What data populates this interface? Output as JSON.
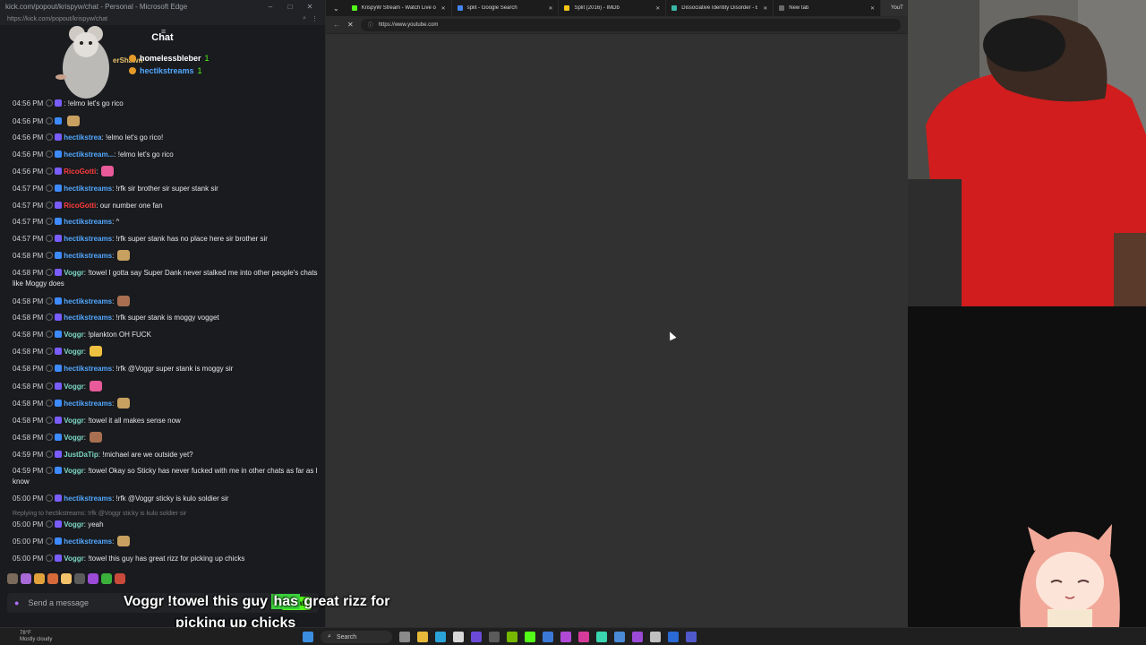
{
  "chat_window": {
    "title": "kick.com/popout/krispyw/chat - Personal - Microsoft Edge",
    "url": "https://kick.com/popout/krispyw/chat",
    "header": "Chat",
    "pinned_label": "erShawn",
    "gifters": [
      {
        "name": "homelessbleber",
        "count": "1"
      },
      {
        "name": "hectikstreams",
        "count": "1"
      }
    ],
    "messages": [
      {
        "time": "04:56 PM",
        "user": "",
        "text": ": !elmo let's go rico",
        "color": "#53a8ff"
      },
      {
        "time": "04:56 PM",
        "user": "",
        "text": "",
        "color": "#ff4040"
      },
      {
        "time": "04:56 PM",
        "user": "hectikstrea",
        "text": ": !elmo let's go rico!",
        "color": "#53a8ff"
      },
      {
        "time": "04:56 PM",
        "user": "hectikstream...",
        "text": ": !elmo let's go rico",
        "color": "#53a8ff"
      },
      {
        "time": "04:56 PM",
        "user": "RicoGotti",
        "text": ":",
        "color": "#ff3b3b"
      },
      {
        "time": "04:57 PM",
        "user": "hectikstreams",
        "text": ": !rfk sir brother sir super stank sir",
        "color": "#53a8ff"
      },
      {
        "time": "04:57 PM",
        "user": "RicoGotti",
        "text": ": our number one fan",
        "color": "#ff3b3b"
      },
      {
        "time": "04:57 PM",
        "user": "hectikstreams",
        "text": ": ^",
        "color": "#53a8ff"
      },
      {
        "time": "04:57 PM",
        "user": "hectikstreams",
        "text": ": !rfk super stank has no place here sir brother sir",
        "color": "#53a8ff"
      },
      {
        "time": "04:58 PM",
        "user": "hectikstreams",
        "text": ":",
        "color": "#53a8ff"
      },
      {
        "time": "04:58 PM",
        "user": "Voggr",
        "text": ": !towel I gotta say Super Dank never stalked me into other people's chats like Moggy does",
        "color": "#7cd7c4"
      },
      {
        "time": "04:58 PM",
        "user": "hectikstreams",
        "text": ":",
        "color": "#53a8ff"
      },
      {
        "time": "04:58 PM",
        "user": "hectikstreams",
        "text": ": !rfk super stank is moggy vogget",
        "color": "#53a8ff"
      },
      {
        "time": "04:58 PM",
        "user": "Voggr",
        "text": ": !plankton OH FUCK",
        "color": "#7cd7c4"
      },
      {
        "time": "04:58 PM",
        "user": "Voggr",
        "text": ":",
        "color": "#7cd7c4"
      },
      {
        "time": "04:58 PM",
        "user": "hectikstreams",
        "text": ": !rfk @Voggr super stank is moggy sir",
        "color": "#53a8ff"
      },
      {
        "time": "04:58 PM",
        "user": "Voggr",
        "text": ":",
        "color": "#7cd7c4"
      },
      {
        "time": "04:58 PM",
        "user": "hectikstreams",
        "text": ":",
        "color": "#53a8ff"
      },
      {
        "time": "04:58 PM",
        "user": "Voggr",
        "text": ": !towel it all makes sense now",
        "color": "#7cd7c4"
      },
      {
        "time": "04:58 PM",
        "user": "Voggr",
        "text": ":",
        "color": "#7cd7c4"
      },
      {
        "time": "04:59 PM",
        "user": "JustDaTip",
        "text": ": !michael are we outside yet?",
        "color": "#7cd7c4"
      },
      {
        "time": "04:59 PM",
        "user": "Voggr",
        "text": ": !towel Okay so Sticky has never fucked with me in other chats as far as I know",
        "color": "#7cd7c4"
      },
      {
        "time": "05:00 PM",
        "user": "hectikstreams",
        "text": ": !rfk @Voggr sticky is kulo soldier sir",
        "color": "#53a8ff"
      }
    ],
    "reply_context": "Replying to hectikstreams: !rfk @Voggr sticky is kulo soldier sir",
    "messages_after": [
      {
        "time": "05:00 PM",
        "user": "Voggr",
        "text": ": yeah",
        "color": "#7cd7c4"
      },
      {
        "time": "05:00 PM",
        "user": "hectikstreams",
        "text": ":",
        "color": "#53a8ff"
      },
      {
        "time": "05:00 PM",
        "user": "Voggr",
        "text": ": !towel this guy has great rizz for picking up chicks",
        "color": "#7cd7c4"
      }
    ],
    "send_placeholder": "Send a message",
    "chat_button": "Chat"
  },
  "browser": {
    "tabs": [
      {
        "label": "KrispyW Stream - Watch Live on K",
        "color": "#53fc18"
      },
      {
        "label": "split - Google Search",
        "color": "#4285f4"
      },
      {
        "label": "Split (2016) - IMDb",
        "color": "#f5c518"
      },
      {
        "label": "Dissociative Identity Disorder - B",
        "color": "#3ab7a8"
      },
      {
        "label": "New tab",
        "color": "#6a6a6a"
      },
      {
        "label": "YouT",
        "color": "#ff0000"
      }
    ],
    "url": "https://www.youtube.com"
  },
  "subtitle": {
    "speaker": "Voggr",
    "line1_pre": "!towel this guy ",
    "line1_hl": "has",
    "line1_post": " great rizz for",
    "line2": "picking up chicks"
  },
  "taskbar": {
    "weather_temp": "78°F",
    "weather_desc": "Mostly cloudy",
    "search_label": "Search"
  }
}
